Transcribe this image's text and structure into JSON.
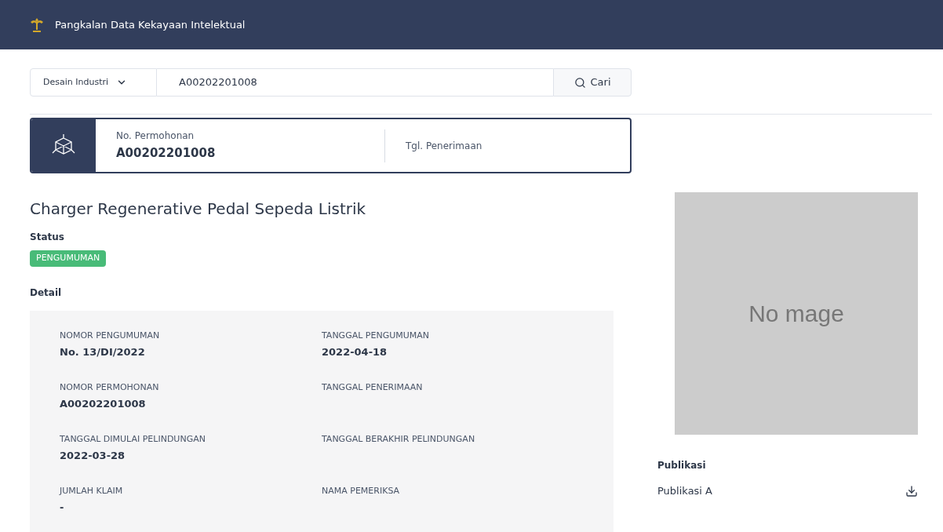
{
  "header": {
    "title": "Pangkalan Data Kekayaan Intelektual"
  },
  "search": {
    "category": "Desain Industri",
    "value": "A00202201008",
    "button": "Cari"
  },
  "summary": {
    "fields": [
      {
        "label": "No. Permohonan",
        "value": "A00202201008"
      },
      {
        "label": "Tgl. Penerimaan"
      }
    ]
  },
  "title": "Charger Regenerative Pedal Sepeda Listrik",
  "status": {
    "heading": "Status",
    "badge": "PENGUMUMAN"
  },
  "detail": {
    "heading": "Detail",
    "fields": [
      {
        "label": "NOMOR PENGUMUMAN",
        "value": "No. 13/DI/2022"
      },
      {
        "label": "TANGGAL PENGUMUMAN",
        "value": "2022-04-18"
      },
      {
        "label": "NOMOR PERMOHONAN",
        "value": "A00202201008"
      },
      {
        "label": "TANGGAL PENERIMAAN"
      },
      {
        "label": "TANGGAL DIMULAI PELINDUNGAN",
        "value": "2022-03-28"
      },
      {
        "label": "TANGGAL BERAKHIR PELINDUNGAN"
      },
      {
        "label": "JUMLAH KLAIM",
        "value": "-"
      },
      {
        "label": "NAMA PEMERIKSA"
      }
    ]
  },
  "image": {
    "placeholder_text": "No mage"
  },
  "publikasi": {
    "heading": "Publikasi",
    "items": [
      "Publikasi A"
    ]
  }
}
